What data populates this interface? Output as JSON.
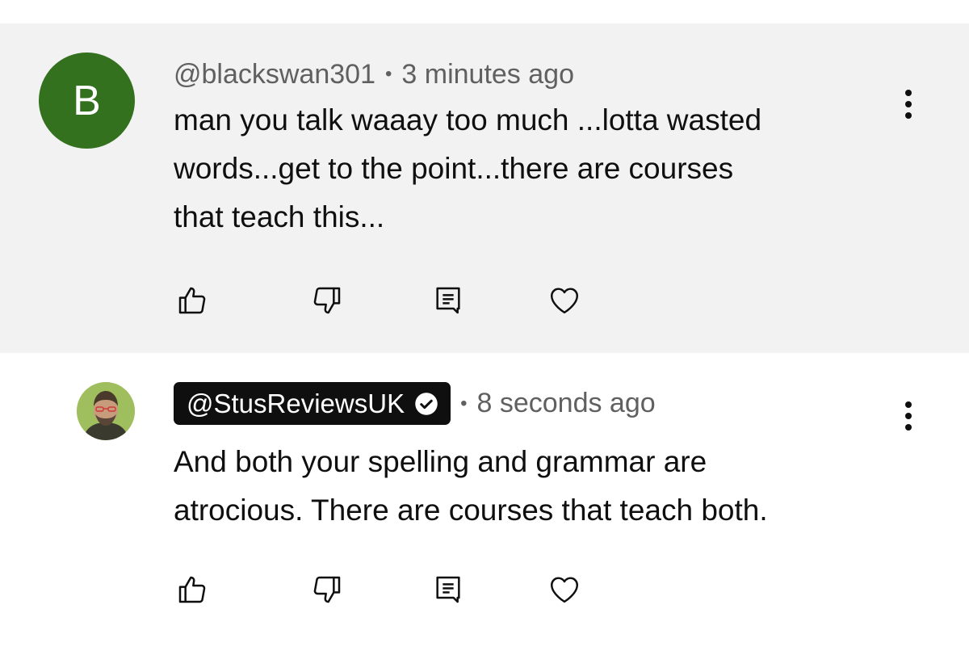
{
  "comments": [
    {
      "avatar_letter": "B",
      "avatar_color": "#33711f",
      "author": "@blackswan301",
      "separator": "•",
      "time": "3 minutes ago",
      "text": "man you talk waaay too much ...lotta wasted\nwords...get to the point...there are courses\nthat teach this...",
      "highlighted_bg": "#f2f2f2"
    },
    {
      "author": "@StusReviewsUK",
      "verified": true,
      "separator": "•",
      "time": "8 seconds ago",
      "text": "And both your spelling and grammar are\natrocious. There are courses that teach both.",
      "pill_bg": "#0f0f0f"
    }
  ],
  "icons": {
    "more": "vertical-ellipsis-icon",
    "like": "thumbs-up-icon",
    "dislike": "thumbs-down-icon",
    "reply": "reply-comment-icon",
    "heart": "heart-icon",
    "verified": "verified-check-icon"
  }
}
